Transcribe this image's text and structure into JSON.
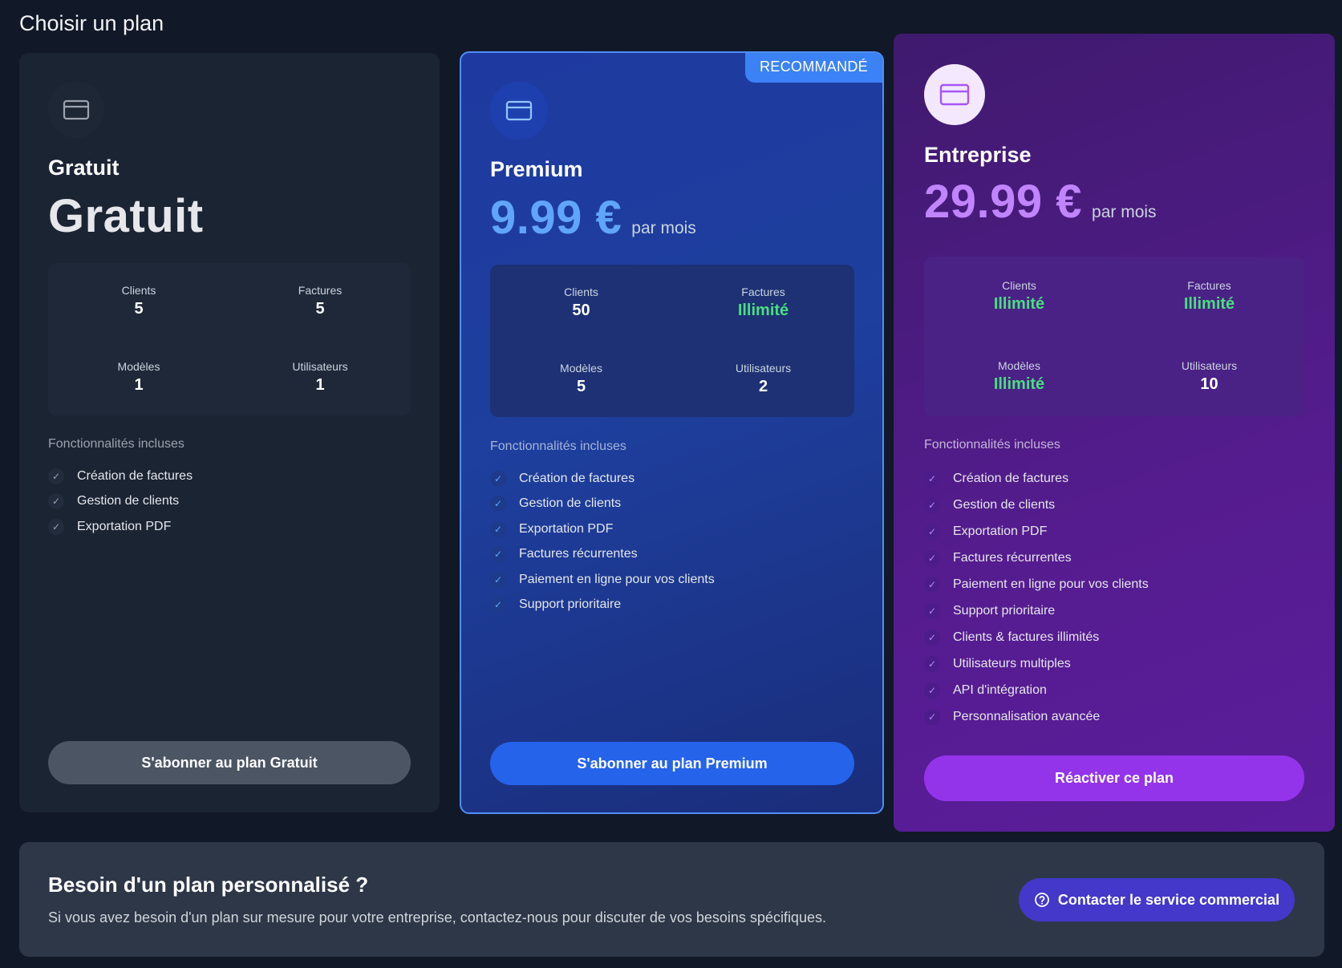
{
  "page": {
    "title": "Choisir un plan"
  },
  "plans": [
    {
      "name": "Gratuit",
      "price": "Gratuit",
      "period": "",
      "icon": "credit-card-icon",
      "stats": {
        "clients_label": "Clients",
        "clients_value": "5",
        "invoices_label": "Factures",
        "invoices_value": "5",
        "templates_label": "Modèles",
        "templates_value": "1",
        "users_label": "Utilisateurs",
        "users_value": "1"
      },
      "features_title": "Fonctionnalités incluses",
      "features": [
        "Création de factures",
        "Gestion de clients",
        "Exportation PDF"
      ],
      "cta": "S'abonner au plan Gratuit"
    },
    {
      "name": "Premium",
      "price": "9.99 €",
      "period": "par mois",
      "badge": "RECOMMANDÉ",
      "icon": "credit-card-icon",
      "stats": {
        "clients_label": "Clients",
        "clients_value": "50",
        "invoices_label": "Factures",
        "invoices_value": "Illimité",
        "templates_label": "Modèles",
        "templates_value": "5",
        "users_label": "Utilisateurs",
        "users_value": "2"
      },
      "features_title": "Fonctionnalités incluses",
      "features": [
        "Création de factures",
        "Gestion de clients",
        "Exportation PDF",
        "Factures récurrentes",
        "Paiement en ligne pour vos clients",
        "Support prioritaire"
      ],
      "cta": "S'abonner au plan Premium"
    },
    {
      "name": "Entreprise",
      "price": "29.99 €",
      "period": "par mois",
      "icon": "credit-card-icon",
      "stats": {
        "clients_label": "Clients",
        "clients_value": "Illimité",
        "invoices_label": "Factures",
        "invoices_value": "Illimité",
        "templates_label": "Modèles",
        "templates_value": "Illimité",
        "users_label": "Utilisateurs",
        "users_value": "10"
      },
      "features_title": "Fonctionnalités incluses",
      "features": [
        "Création de factures",
        "Gestion de clients",
        "Exportation PDF",
        "Factures récurrentes",
        "Paiement en ligne pour vos clients",
        "Support prioritaire",
        "Clients & factures illimités",
        "Utilisateurs multiples",
        "API d'intégration",
        "Personnalisation avancée"
      ],
      "cta": "Réactiver ce plan"
    }
  ],
  "custom": {
    "title": "Besoin d'un plan personnalisé ?",
    "description": "Si vous avez besoin d'un plan sur mesure pour votre entreprise, contactez-nous pour discuter de vos besoins spécifiques.",
    "button": "Contacter le service commercial",
    "button_icon": "help-circle-icon"
  },
  "colors": {
    "background": "#111827",
    "premium_accent": "#60a5fa",
    "enterprise_accent": "#c084fc",
    "unlimited_green": "#4ade80"
  }
}
